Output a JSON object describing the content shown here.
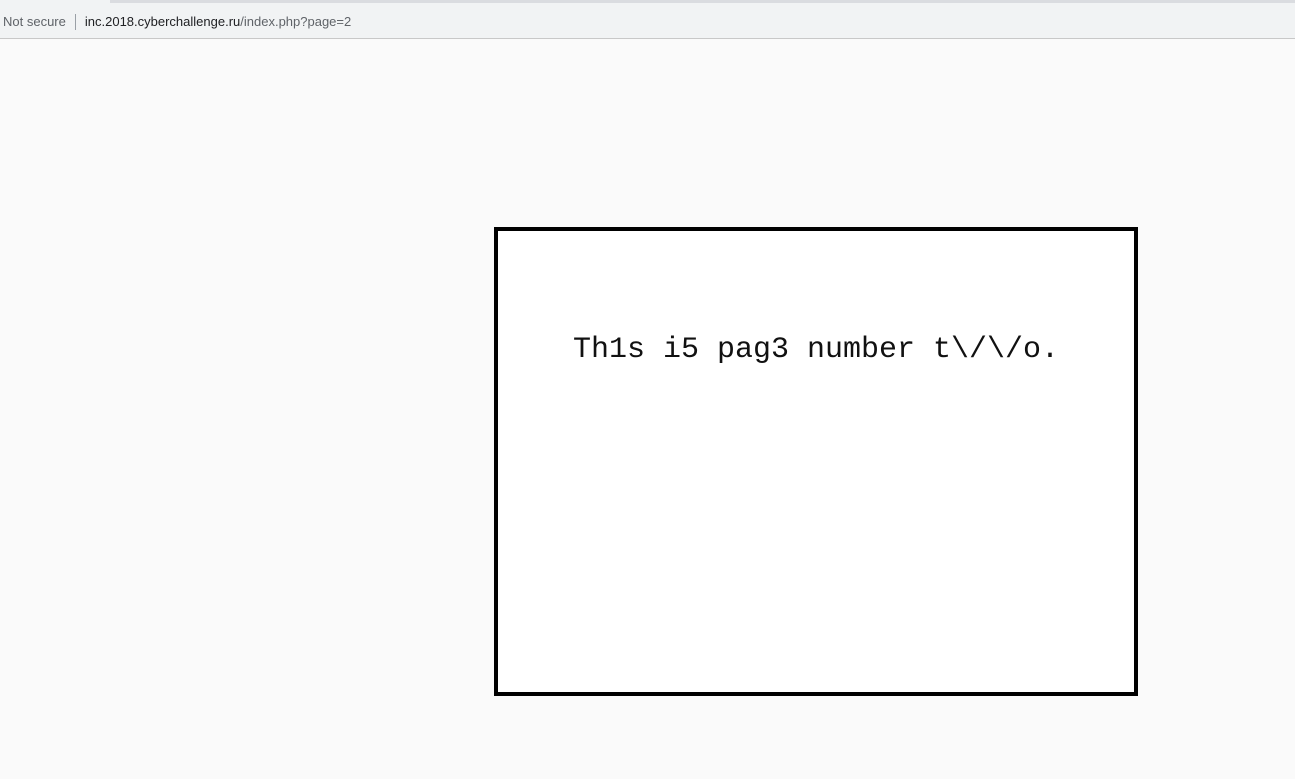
{
  "browser": {
    "security_label": "Not secure",
    "url_host": "inc.2018.cyberchallenge.ru",
    "url_path": "/index.php?page=2"
  },
  "page": {
    "message": "Th1s i5 pag3 number t\\/\\/o."
  }
}
